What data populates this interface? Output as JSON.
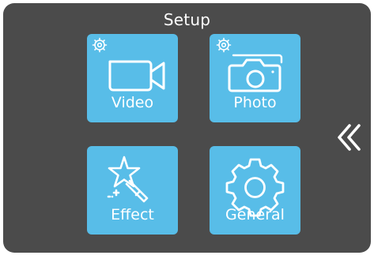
{
  "header": {
    "title": "Setup"
  },
  "menu": {
    "items": [
      {
        "label": "Video",
        "icon": "video-camera-settings-icon"
      },
      {
        "label": "Photo",
        "icon": "photo-camera-settings-icon"
      },
      {
        "label": "Effect",
        "icon": "magic-wand-icon"
      },
      {
        "label": "General",
        "icon": "gear-icon"
      }
    ]
  },
  "nav": {
    "back_icon": "double-chevron-left-icon"
  },
  "colors": {
    "screen_background": "#4b4b4b",
    "tile_background": "#58bde8",
    "foreground": "#ffffff"
  }
}
